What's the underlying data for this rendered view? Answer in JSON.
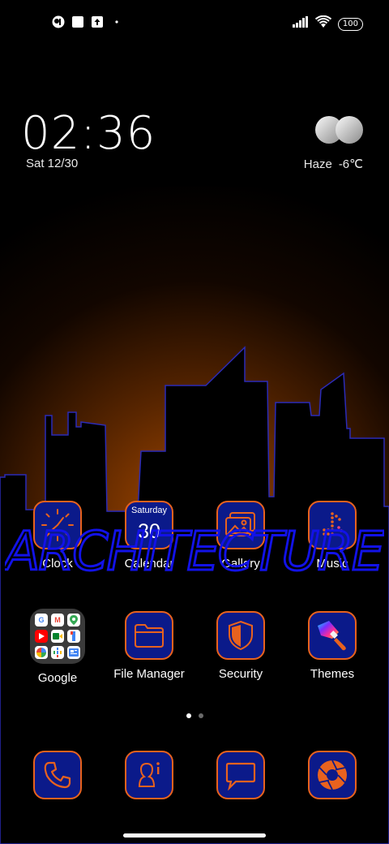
{
  "status_bar": {
    "left_icons": [
      "clock-mask-icon",
      "white-square-icon",
      "upload-icon",
      "dot-icon"
    ],
    "right_icons": [
      "signal-icon",
      "wifi-icon"
    ],
    "battery": "100"
  },
  "lockclock": {
    "time": "02:36",
    "date": "Sat 12/30",
    "weather_condition": "Haze",
    "temperature": "-6℃"
  },
  "overlay_text": "ARCHITECTURE",
  "apps_row1": [
    {
      "label": "Clock",
      "icon": "clock-icon"
    },
    {
      "label": "Calendar",
      "icon": "calendar-icon",
      "day": "Saturday",
      "date": "30"
    },
    {
      "label": "Gallery",
      "icon": "gallery-icon"
    },
    {
      "label": "Music",
      "icon": "music-icon"
    }
  ],
  "apps_row2": [
    {
      "label": "Google",
      "icon": "google-folder-icon"
    },
    {
      "label": "File Manager",
      "icon": "folder-icon"
    },
    {
      "label": "Security",
      "icon": "shield-icon"
    },
    {
      "label": "Themes",
      "icon": "paintbrush-icon"
    }
  ],
  "dock": [
    {
      "icon": "phone-icon"
    },
    {
      "icon": "contacts-icon"
    },
    {
      "icon": "messages-icon"
    },
    {
      "icon": "camera-aperture-icon"
    }
  ],
  "page_indicator": {
    "pages": 2,
    "current": 1
  },
  "colors": {
    "accent_orange": "#e8621e",
    "tile_blue": "#0b1a8a",
    "outline_blue": "#1212e8",
    "glow_orange": "#8a3a00"
  }
}
